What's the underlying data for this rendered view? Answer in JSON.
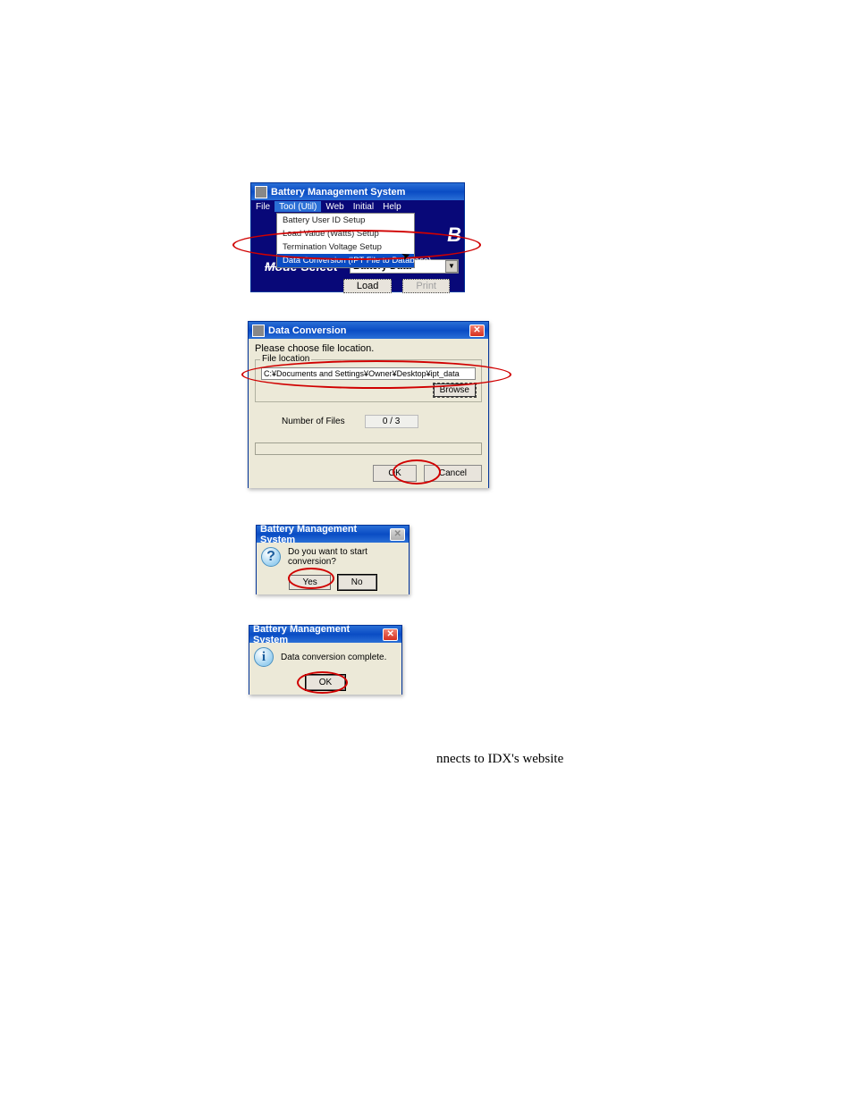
{
  "win1": {
    "title": "Battery Management System",
    "menu": {
      "file": "File",
      "tool": "Tool (Util)",
      "web": "Web",
      "initial": "Initial",
      "help": "Help"
    },
    "dropdown": {
      "item1": "Battery User ID Setup",
      "item2": "Load Value (Watts) Setup",
      "item3": "Termination Voltage Setup",
      "item4": "Data Conversion (IPT File to Database)"
    },
    "body_letter": "B",
    "mode_label": "Mode Select",
    "mode_value": "Battery Data",
    "load_btn": "Load",
    "print_btn": "Print"
  },
  "win2": {
    "title": "Data Conversion",
    "line1": "Please choose file location.",
    "fieldset_label": "File location",
    "path": "C:¥Documents and Settings¥Owner¥Desktop¥ipt_data",
    "browse_btn": "Browse",
    "num_files_label": "Number of Files",
    "num_files_value": "0 / 3",
    "ok_btn": "OK",
    "cancel_btn": "Cancel"
  },
  "win3": {
    "title": "Battery Management System",
    "msg": "Do you want to start conversion?",
    "yes_btn": "Yes",
    "no_btn": "No"
  },
  "win4": {
    "title": "Battery Management System",
    "msg": "Data conversion complete.",
    "ok_btn": "OK"
  },
  "residual": "nnects to IDX's website"
}
